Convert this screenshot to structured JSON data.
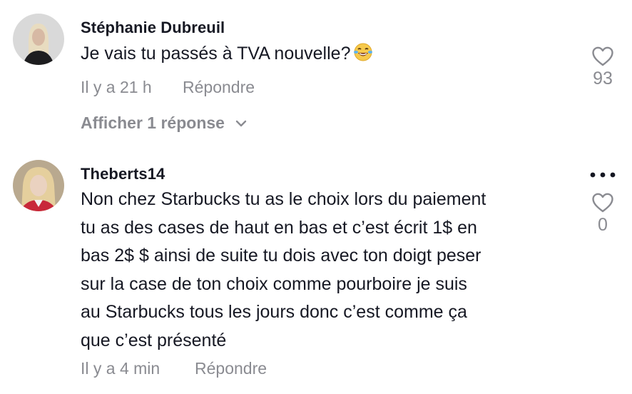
{
  "comments": [
    {
      "username": "Stéphanie Dubreuil",
      "text": "Je vais tu passés à TVA nouvelle?",
      "emoji": "laughing-tears-emoji",
      "time": "Il y a 21 h",
      "reply_label": "Répondre",
      "likes": "93",
      "view_replies_label": "Afficher 1 réponse"
    },
    {
      "username": "Theberts14",
      "text_lines": [
        "Non chez Starbucks tu as le choix lors du paiement",
        "tu as des cases de haut en bas et c’est écrit 1$ en",
        "bas 2$ $ ainsi de suite tu dois avec ton doigt peser",
        "sur la case de ton choix comme pourboire je suis",
        "au Starbucks tous les jours donc c’est comme ça",
        "que c’est présenté"
      ],
      "time": "Il y a 4 min",
      "reply_label": "Répondre",
      "likes": "0"
    }
  ],
  "colors": {
    "text": "#161823",
    "muted": "#8a8b91",
    "background": "#ffffff"
  }
}
